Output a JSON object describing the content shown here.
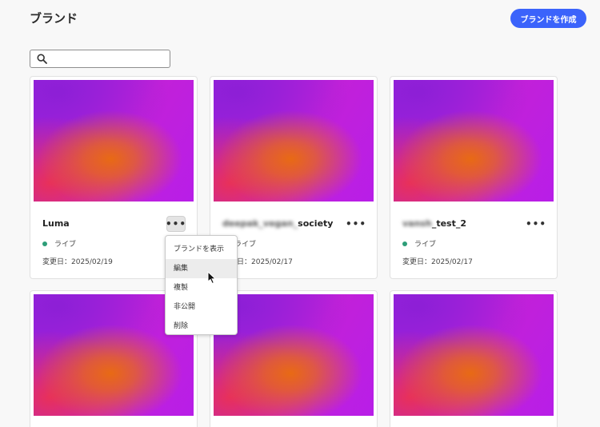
{
  "header": {
    "title": "ブランド",
    "create_button": "ブランドを作成"
  },
  "search": {
    "value": "",
    "placeholder": ""
  },
  "cards": [
    {
      "name_blur": "",
      "name_clear": "Luma",
      "status": "ライブ",
      "modified": "変更日：2025/02/19",
      "more": "•••"
    },
    {
      "name_blur": "deepak_vegan_",
      "name_clear": "society",
      "status": "ライブ",
      "modified": "変更日：2025/02/17",
      "more": "•••"
    },
    {
      "name_blur": "vansh",
      "name_clear": "_test_2",
      "status": "ライブ",
      "modified": "変更日：2025/02/17",
      "more": "•••"
    }
  ],
  "context_menu": {
    "items": [
      "ブランドを表示",
      "編集",
      "複製",
      "非公開",
      "削除"
    ],
    "hovered_index": 1
  },
  "colors": {
    "accent": "#3b63fb",
    "status_live": "#2d9d78",
    "background": "#f8f8f8"
  },
  "icons": {
    "search": "search-icon",
    "more": "more-icon",
    "cursor": "mouse-pointer-icon"
  }
}
